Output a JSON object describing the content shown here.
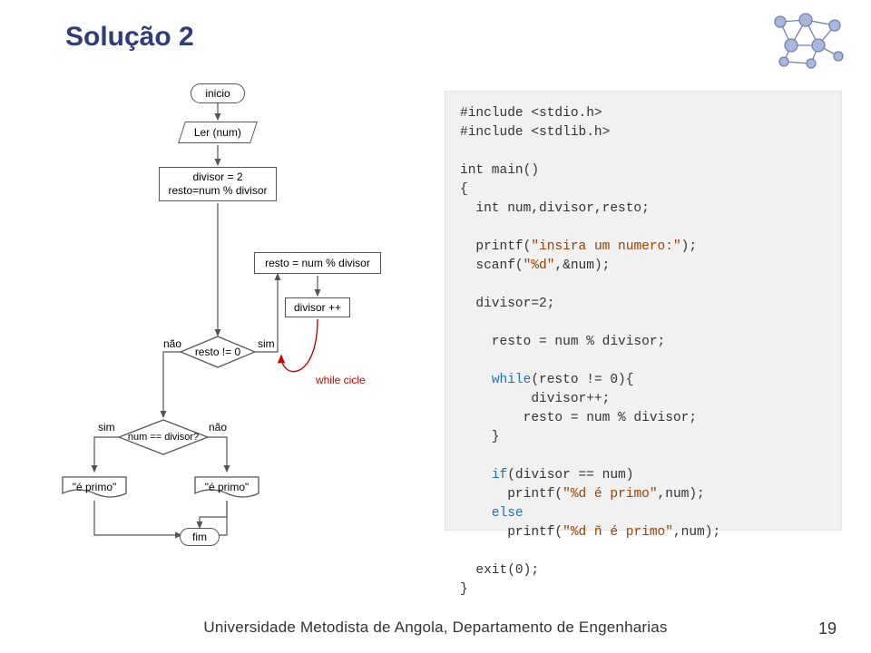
{
  "title": "Solução 2",
  "flow": {
    "inicio": "inicio",
    "ler": "Ler (num)",
    "init_block": "divisor = 2\nresto=num % divisor",
    "resto_block": "resto = num % divisor",
    "divpp": "divisor ++",
    "cond_resto": "resto != 0",
    "cond_num": "num == divisor?",
    "primo1": "\"é primo\"",
    "primo2": "\"é primo\"",
    "fim": "fim",
    "sim1": "sim",
    "nao1": "não",
    "sim2": "sim",
    "nao2": "não",
    "while": "while cicle"
  },
  "code": {
    "l1": "#include <stdio.h>",
    "l2": "#include <stdlib.h>",
    "l3": "int main()",
    "l4": "{",
    "l5": "  int num,divisor,resto;",
    "l6": "  printf(",
    "s6": "\"insira um numero:\"",
    "l6b": ");",
    "l7": "  scanf(",
    "s7": "\"%d\"",
    "l7b": ",&num);",
    "l8": "  divisor=2;",
    "l9": "    resto = num % divisor;",
    "l10a": "    ",
    "l10kw": "while",
    "l10b": "(resto != 0){",
    "l11": "         divisor++;",
    "l12": "        resto = num % divisor;",
    "l13": "    }",
    "l14a": "    ",
    "l14kw": "if",
    "l14b": "(divisor == num)",
    "l15": "      printf(",
    "s15": "\"%d é primo\"",
    "l15b": ",num);",
    "l16kw": "    else",
    "l17": "      printf(",
    "s17": "\"%d ñ é primo\"",
    "l17b": ",num);",
    "l18": "  exit(0);",
    "l19": "}"
  },
  "footer": "Universidade Metodista de Angola, Departamento de Engenharias",
  "pagenum": "19"
}
